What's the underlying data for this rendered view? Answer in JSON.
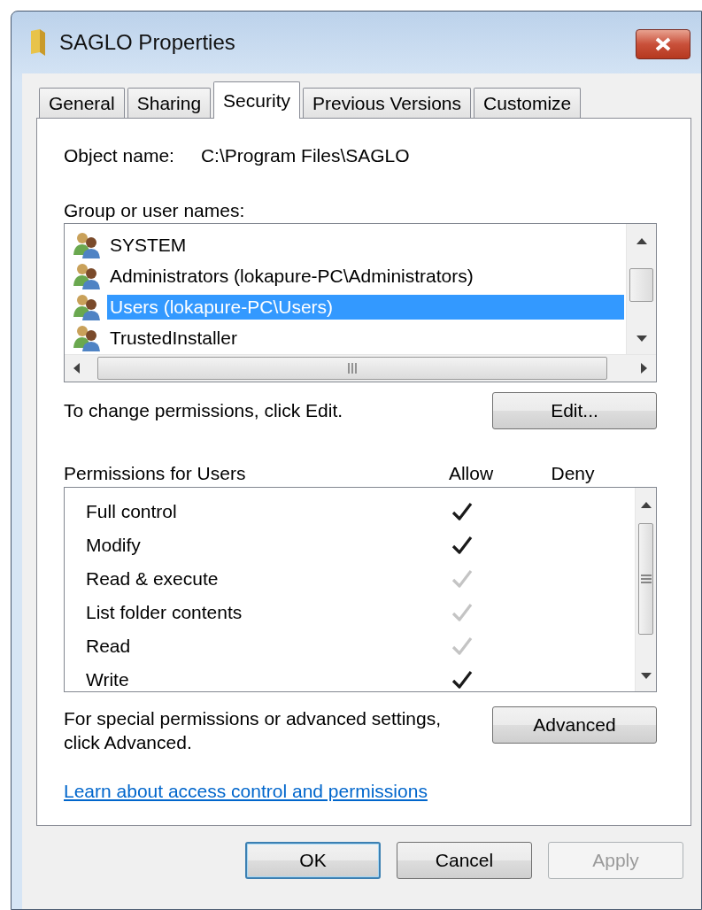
{
  "window": {
    "title": "SAGLO Properties"
  },
  "tabs": [
    {
      "label": "General",
      "selected": false
    },
    {
      "label": "Sharing",
      "selected": false
    },
    {
      "label": "Security",
      "selected": true
    },
    {
      "label": "Previous Versions",
      "selected": false
    },
    {
      "label": "Customize",
      "selected": false
    }
  ],
  "object_name": {
    "label": "Object name:",
    "value": "C:\\Program Files\\SAGLO"
  },
  "users": {
    "label": "Group or user names:",
    "items": [
      {
        "name": "SYSTEM",
        "selected": false
      },
      {
        "name": "Administrators (lokapure-PC\\Administrators)",
        "selected": false
      },
      {
        "name": "Users (lokapure-PC\\Users)",
        "selected": true
      },
      {
        "name": "TrustedInstaller",
        "selected": false
      }
    ]
  },
  "change_hint": "To change permissions, click Edit.",
  "edit_button": "Edit...",
  "permissions": {
    "title": "Permissions for Users",
    "allow_heading": "Allow",
    "deny_heading": "Deny",
    "items": [
      {
        "name": "Full control",
        "allow": true,
        "inherited": false
      },
      {
        "name": "Modify",
        "allow": true,
        "inherited": false
      },
      {
        "name": "Read & execute",
        "allow": true,
        "inherited": true
      },
      {
        "name": "List folder contents",
        "allow": true,
        "inherited": true
      },
      {
        "name": "Read",
        "allow": true,
        "inherited": true
      },
      {
        "name": "Write",
        "allow": true,
        "inherited": false
      }
    ]
  },
  "advanced_hint": "For special permissions or advanced settings, click Advanced.",
  "advanced_button": "Advanced",
  "learn_link": "Learn about access control and permissions",
  "buttons": [
    {
      "label": "OK",
      "kind": "default",
      "disabled": false
    },
    {
      "label": "Cancel",
      "kind": "normal",
      "disabled": false
    },
    {
      "label": "Apply",
      "kind": "normal",
      "disabled": true
    }
  ]
}
